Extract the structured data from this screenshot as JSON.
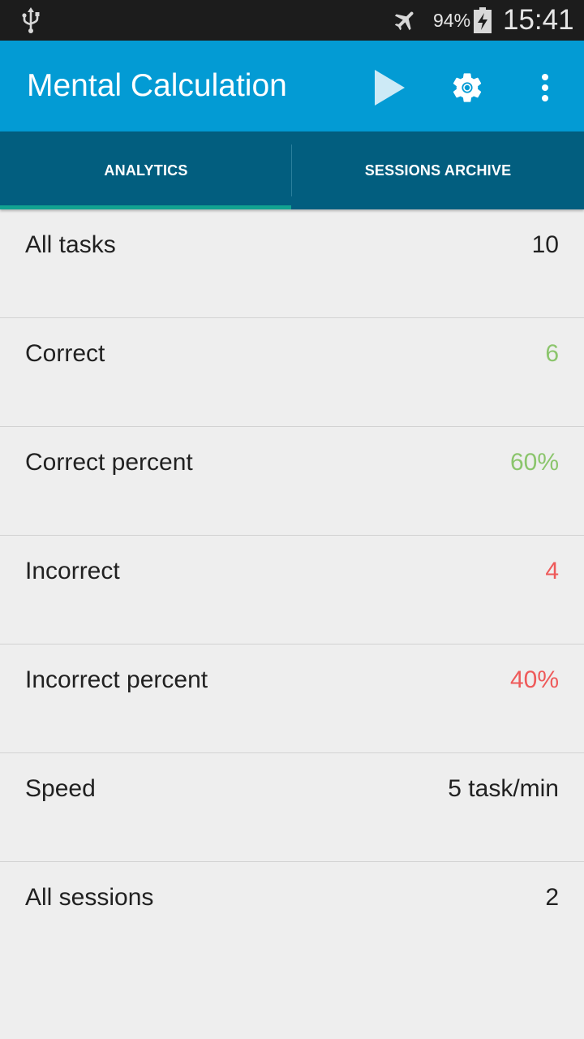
{
  "status_bar": {
    "battery_percent": "94%",
    "time": "15:41",
    "icons": [
      "usb-icon",
      "airplane-mode-icon",
      "battery-charging-icon"
    ]
  },
  "app_bar": {
    "title": "Mental Calculation",
    "actions": [
      "play-icon",
      "gear-icon",
      "overflow-menu-icon"
    ],
    "color": "#039bd4"
  },
  "tabs": {
    "items": [
      {
        "label": "ANALYTICS",
        "selected": true
      },
      {
        "label": "SESSIONS ARCHIVE",
        "selected": false
      }
    ],
    "color": "#025e7f",
    "indicator_color": "#11a391"
  },
  "stats": [
    {
      "label": "All tasks",
      "value": "10",
      "tone": "neutral"
    },
    {
      "label": "Correct",
      "value": "6",
      "tone": "green"
    },
    {
      "label": "Correct percent",
      "value": "60%",
      "tone": "green"
    },
    {
      "label": "Incorrect",
      "value": "4",
      "tone": "red"
    },
    {
      "label": "Incorrect percent",
      "value": "40%",
      "tone": "red"
    },
    {
      "label": "Speed",
      "value": "5 task/min",
      "tone": "neutral"
    },
    {
      "label": "All sessions",
      "value": "2",
      "tone": "neutral"
    }
  ],
  "colors": {
    "green": "#8bc56c",
    "red": "#ee5a5a",
    "text": "#212121",
    "background": "#eeeeee"
  }
}
